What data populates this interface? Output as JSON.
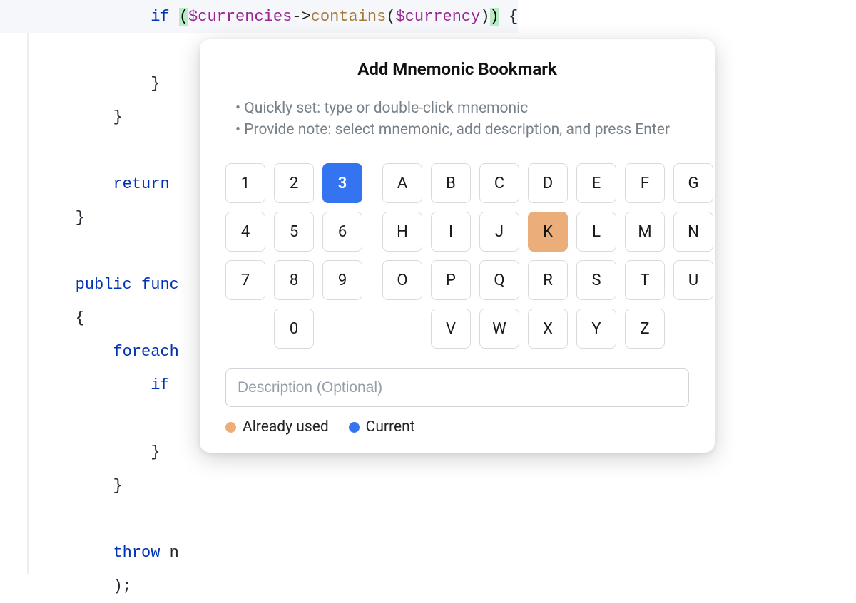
{
  "code": {
    "lines": [
      {
        "indent": "            ",
        "tokens": [
          {
            "t": "kw",
            "v": "if "
          },
          {
            "t": "match-paren",
            "v": "("
          },
          {
            "t": "var",
            "v": "$currencies"
          },
          {
            "t": "op",
            "v": "->"
          },
          {
            "t": "fn",
            "v": "contains"
          },
          {
            "t": "plain",
            "v": "("
          },
          {
            "t": "var",
            "v": "$currency"
          },
          {
            "t": "plain",
            "v": ")"
          },
          {
            "t": "match-paren",
            "v": ")"
          },
          {
            "t": "plain",
            "v": " {"
          }
        ],
        "hl": true
      },
      {
        "indent": "",
        "tokens": []
      },
      {
        "indent": "            ",
        "tokens": [
          {
            "t": "plain",
            "v": "}"
          }
        ]
      },
      {
        "indent": "        ",
        "tokens": [
          {
            "t": "plain",
            "v": "}"
          }
        ]
      },
      {
        "indent": "",
        "tokens": []
      },
      {
        "indent": "        ",
        "tokens": [
          {
            "t": "kw",
            "v": "return"
          }
        ]
      },
      {
        "indent": "    ",
        "tokens": [
          {
            "t": "plain",
            "v": "}"
          }
        ]
      },
      {
        "indent": "",
        "tokens": []
      },
      {
        "indent": "    ",
        "tokens": [
          {
            "t": "kw",
            "v": "public "
          },
          {
            "t": "kw",
            "v": "func"
          }
        ]
      },
      {
        "indent": "    ",
        "tokens": [
          {
            "t": "plain",
            "v": "{"
          }
        ]
      },
      {
        "indent": "        ",
        "tokens": [
          {
            "t": "kw",
            "v": "foreach"
          }
        ]
      },
      {
        "indent": "            ",
        "tokens": [
          {
            "t": "kw",
            "v": "if"
          }
        ]
      },
      {
        "indent": "",
        "tokens": []
      },
      {
        "indent": "            ",
        "tokens": [
          {
            "t": "plain",
            "v": "}"
          }
        ]
      },
      {
        "indent": "        ",
        "tokens": [
          {
            "t": "plain",
            "v": "}"
          }
        ]
      },
      {
        "indent": "",
        "tokens": []
      },
      {
        "indent": "        ",
        "tokens": [
          {
            "t": "kw",
            "v": "throw "
          },
          {
            "t": "plain",
            "v": "n"
          }
        ]
      },
      {
        "indent": "        ",
        "tokens": [
          {
            "t": "plain",
            "v": ");"
          }
        ]
      }
    ]
  },
  "dialog": {
    "title": "Add Mnemonic Bookmark",
    "bullets": [
      "Quickly set: type or double-click mnemonic",
      "Provide note: select mnemonic, add description, and press Enter"
    ],
    "numbers": [
      {
        "label": "1",
        "state": "default"
      },
      {
        "label": "2",
        "state": "default"
      },
      {
        "label": "3",
        "state": "current"
      },
      {
        "label": "4",
        "state": "default"
      },
      {
        "label": "5",
        "state": "default"
      },
      {
        "label": "6",
        "state": "default"
      },
      {
        "label": "7",
        "state": "default"
      },
      {
        "label": "8",
        "state": "default"
      },
      {
        "label": "9",
        "state": "default"
      },
      {
        "label": "",
        "state": "empty"
      },
      {
        "label": "0",
        "state": "default"
      },
      {
        "label": "",
        "state": "empty"
      }
    ],
    "letters": [
      {
        "label": "A",
        "state": "default"
      },
      {
        "label": "B",
        "state": "default"
      },
      {
        "label": "C",
        "state": "default"
      },
      {
        "label": "D",
        "state": "default"
      },
      {
        "label": "E",
        "state": "default"
      },
      {
        "label": "F",
        "state": "default"
      },
      {
        "label": "G",
        "state": "default"
      },
      {
        "label": "H",
        "state": "default"
      },
      {
        "label": "I",
        "state": "default"
      },
      {
        "label": "J",
        "state": "default"
      },
      {
        "label": "K",
        "state": "used"
      },
      {
        "label": "L",
        "state": "default"
      },
      {
        "label": "M",
        "state": "default"
      },
      {
        "label": "N",
        "state": "default"
      },
      {
        "label": "O",
        "state": "default"
      },
      {
        "label": "P",
        "state": "default"
      },
      {
        "label": "Q",
        "state": "default"
      },
      {
        "label": "R",
        "state": "default"
      },
      {
        "label": "S",
        "state": "default"
      },
      {
        "label": "T",
        "state": "default"
      },
      {
        "label": "U",
        "state": "default"
      },
      {
        "label": "",
        "state": "empty"
      },
      {
        "label": "V",
        "state": "default"
      },
      {
        "label": "W",
        "state": "default"
      },
      {
        "label": "X",
        "state": "default"
      },
      {
        "label": "Y",
        "state": "default"
      },
      {
        "label": "Z",
        "state": "default"
      },
      {
        "label": "",
        "state": "empty"
      }
    ],
    "description_placeholder": "Description (Optional)",
    "legend": {
      "used": "Already used",
      "current": "Current"
    }
  }
}
